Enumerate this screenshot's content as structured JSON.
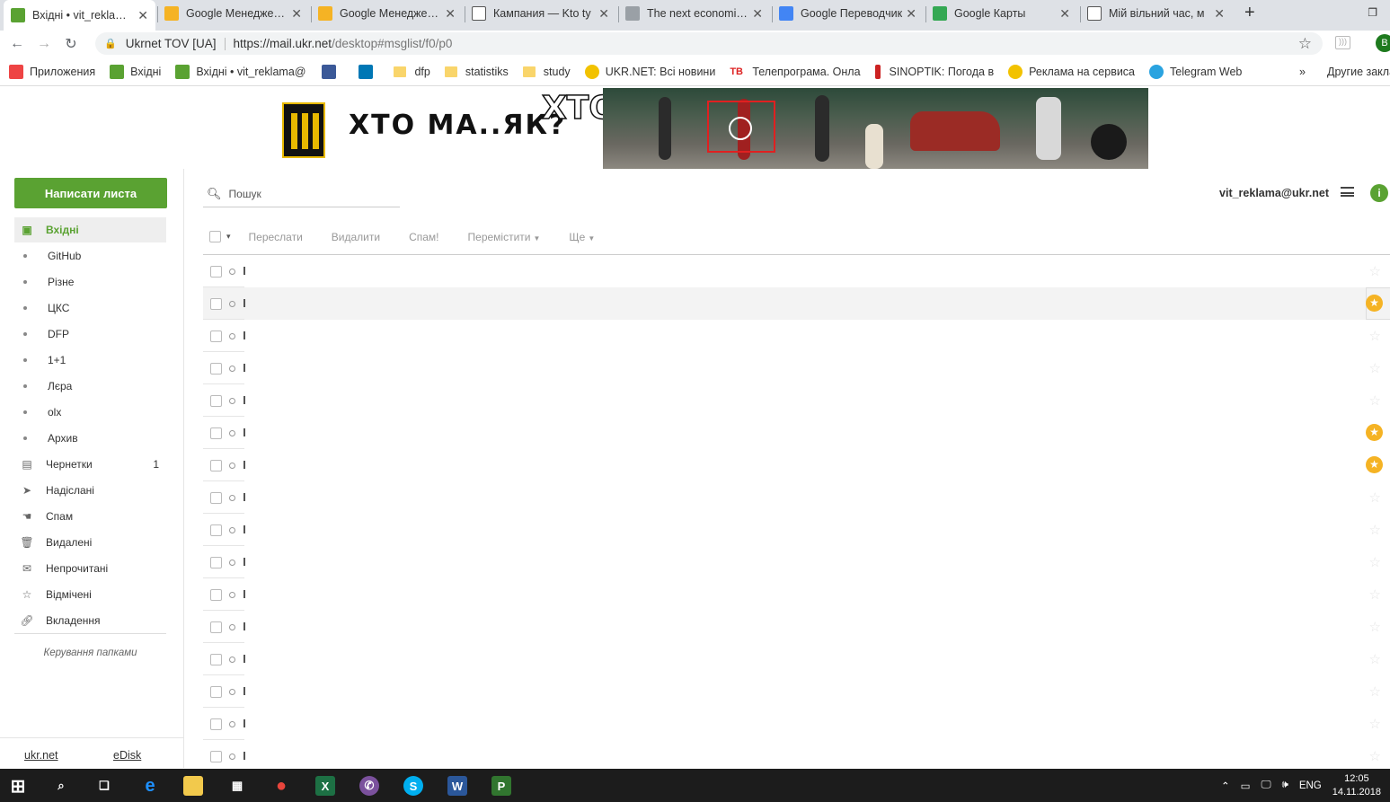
{
  "browser": {
    "tabs": [
      {
        "title": "Вхідні • vit_reklama@",
        "favicon": "ukrnet-mail-icon",
        "active": true
      },
      {
        "title": "Google Менеджер ре",
        "favicon": "google-ads-icon",
        "active": false
      },
      {
        "title": "Google Менеджер ре",
        "favicon": "google-ads-icon",
        "active": false
      },
      {
        "title": "Кампания — Kto ty",
        "favicon": "page-icon",
        "active": false
      },
      {
        "title": "The next economic c",
        "favicon": "news-icon",
        "active": false
      },
      {
        "title": "Google Переводчик",
        "favicon": "google-translate-icon",
        "active": false
      },
      {
        "title": "Google Карты",
        "favicon": "google-maps-icon",
        "active": false
      },
      {
        "title": "Мій вільний час, м",
        "favicon": "page-icon",
        "active": false
      }
    ],
    "newtab_label": "+",
    "omnibox": {
      "site": "Ukrnet TOV [UA]",
      "url_host": "https://mail.ukr.net",
      "url_path": "/desktop#msglist/f0/p0"
    },
    "profile_initial": "B",
    "bookmarks": [
      {
        "label": "Приложения",
        "icon": "apps-grid-icon"
      },
      {
        "label": "Вхідні",
        "icon": "ukrnet-mail-icon"
      },
      {
        "label": "Вхідні • vit_reklama@",
        "icon": "ukrnet-mail-icon"
      },
      {
        "label": "",
        "icon": "facebook-icon"
      },
      {
        "label": "",
        "icon": "linkedin-icon"
      },
      {
        "label": "dfp",
        "icon": "folder-icon"
      },
      {
        "label": "statistiks",
        "icon": "folder-icon"
      },
      {
        "label": "study",
        "icon": "folder-icon"
      },
      {
        "label": "UKR.NET: Всі новини",
        "icon": "ukrnet-news-icon"
      },
      {
        "label": "Телепрограма. Онла",
        "icon": "tv-icon"
      },
      {
        "label": "SINOPTIK: Погода в",
        "icon": "thermometer-icon"
      },
      {
        "label": "Реклама на сервиса",
        "icon": "ukrnet-news-icon"
      },
      {
        "label": "Telegram Web",
        "icon": "telegram-icon"
      }
    ],
    "bookmarks_overflow": "»",
    "other_bookmarks": "Другие закладки"
  },
  "banner": {
    "title1": "ХТО МА..ЯК?",
    "title2": "ХТО ТИ?"
  },
  "sidebar": {
    "compose_label": "Написати листа",
    "folders": [
      {
        "label": "Вхідні",
        "icon": "inbox-icon",
        "active": true,
        "count": ""
      },
      {
        "label": "GitHub",
        "icon": "dot",
        "count": ""
      },
      {
        "label": "Різне",
        "icon": "dot",
        "count": ""
      },
      {
        "label": "ЦКС",
        "icon": "dot",
        "count": ""
      },
      {
        "label": "DFP",
        "icon": "dot",
        "count": ""
      },
      {
        "label": "1+1",
        "icon": "dot",
        "count": ""
      },
      {
        "label": "Лєра",
        "icon": "dot",
        "count": ""
      },
      {
        "label": "olx",
        "icon": "dot",
        "count": ""
      },
      {
        "label": "Архив",
        "icon": "dot",
        "count": ""
      },
      {
        "label": "Чернетки",
        "icon": "drafts-icon",
        "count": "1"
      },
      {
        "label": "Надіслані",
        "icon": "sent-icon",
        "count": ""
      },
      {
        "label": "Спам",
        "icon": "spam-icon",
        "count": ""
      },
      {
        "label": "Видалені",
        "icon": "trash-icon",
        "count": ""
      },
      {
        "label": "Непрочитані",
        "icon": "unread-icon",
        "count": ""
      },
      {
        "label": "Відмічені",
        "icon": "star-icon",
        "count": ""
      },
      {
        "label": "Вкладення",
        "icon": "attachment-icon",
        "count": ""
      }
    ],
    "manage_label": "Керування папками",
    "footer_links": [
      "ukr.net",
      "eDisk"
    ]
  },
  "main": {
    "search_placeholder": "Пошук",
    "account": "vit_reklama@ukr.net",
    "actions": [
      {
        "label": "Переслати",
        "dropdown": false
      },
      {
        "label": "Видалити",
        "dropdown": false
      },
      {
        "label": "Спам!",
        "dropdown": false
      },
      {
        "label": "Перемістити",
        "dropdown": true
      },
      {
        "label": "Ще",
        "dropdown": true
      }
    ],
    "messages": [
      {
        "starred": false,
        "hover": false
      },
      {
        "starred": true,
        "hover": true
      },
      {
        "starred": false,
        "hover": false
      },
      {
        "starred": false,
        "hover": false
      },
      {
        "starred": false,
        "hover": false
      },
      {
        "starred": true,
        "hover": false
      },
      {
        "starred": true,
        "hover": false
      },
      {
        "starred": false,
        "hover": false
      },
      {
        "starred": false,
        "hover": false
      },
      {
        "starred": false,
        "hover": false
      },
      {
        "starred": false,
        "hover": false
      },
      {
        "starred": false,
        "hover": false
      },
      {
        "starred": false,
        "hover": false
      },
      {
        "starred": false,
        "hover": false
      },
      {
        "starred": false,
        "hover": false
      },
      {
        "starred": false,
        "hover": false
      }
    ]
  },
  "taskbar": {
    "apps": [
      "windows-start-icon",
      "search-icon",
      "task-view-icon",
      "edge-icon",
      "file-explorer-icon",
      "calculator-icon",
      "chrome-icon",
      "excel-icon",
      "viber-icon",
      "skype-icon",
      "word-icon",
      "project-icon"
    ],
    "language": "ENG",
    "time": "12:05",
    "date": "14.11.2018"
  },
  "colors": {
    "accent": "#5aa232",
    "star": "#f5b324"
  }
}
